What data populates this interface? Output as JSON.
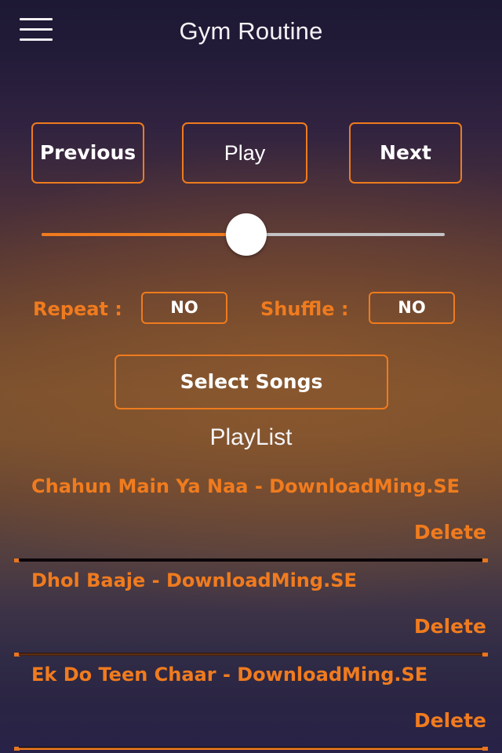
{
  "header": {
    "menu_icon": "hamburger-menu-icon",
    "title": "Gym Routine"
  },
  "transport": {
    "previous_label": "Previous",
    "play_label": "Play",
    "next_label": "Next"
  },
  "progress": {
    "value_percent": 46,
    "fill_color": "#f07b1e",
    "track_color": "#c3c2c4",
    "thumb_color": "#ffffff"
  },
  "options": {
    "repeat_label": "Repeat :",
    "repeat_value": "NO",
    "shuffle_label": "Shuffle :",
    "shuffle_value": "NO"
  },
  "actions": {
    "select_songs_label": "Select Songs"
  },
  "playlist": {
    "heading": "PlayList",
    "delete_label": "Delete",
    "songs": [
      {
        "title": "Chahun Main Ya Naa - DownloadMing.SE",
        "delete_label": "Delete"
      },
      {
        "title": "Dhol Baaje -  DownloadMing.SE",
        "delete_label": "Delete"
      },
      {
        "title": "Ek Do Teen Chaar -  DownloadMing.SE",
        "delete_label": "Delete"
      }
    ]
  },
  "theme": {
    "accent": "#f07b1e",
    "text_light": "#f4f2f6",
    "background_top": "#1d1833",
    "background_mid": "#7b512f",
    "background_bottom": "#282248"
  }
}
